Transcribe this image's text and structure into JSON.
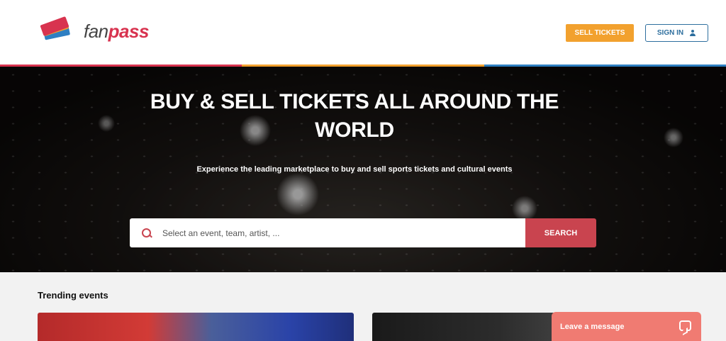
{
  "header": {
    "logo": {
      "fan": "fan",
      "pass": "pass"
    },
    "sell_tickets": "SELL TICKETS",
    "sign_in": "SIGN IN",
    "stripe_colors": [
      "#d8334f",
      "#f2a12e",
      "#2e7fc2"
    ]
  },
  "hero": {
    "title": "BUY & SELL TICKETS ALL AROUND THE WORLD",
    "subtitle": "Experience the leading marketplace to buy and sell sports tickets and cultural events",
    "search_placeholder": "Select an event, team, artist, ...",
    "search_button": "SEARCH"
  },
  "trending": {
    "title": "Trending events"
  },
  "chat": {
    "label": "Leave a message"
  },
  "colors": {
    "accent_red": "#c9444f",
    "accent_orange": "#f2a12e",
    "accent_blue": "#2e6f9e",
    "chat_coral": "#f07b72"
  }
}
